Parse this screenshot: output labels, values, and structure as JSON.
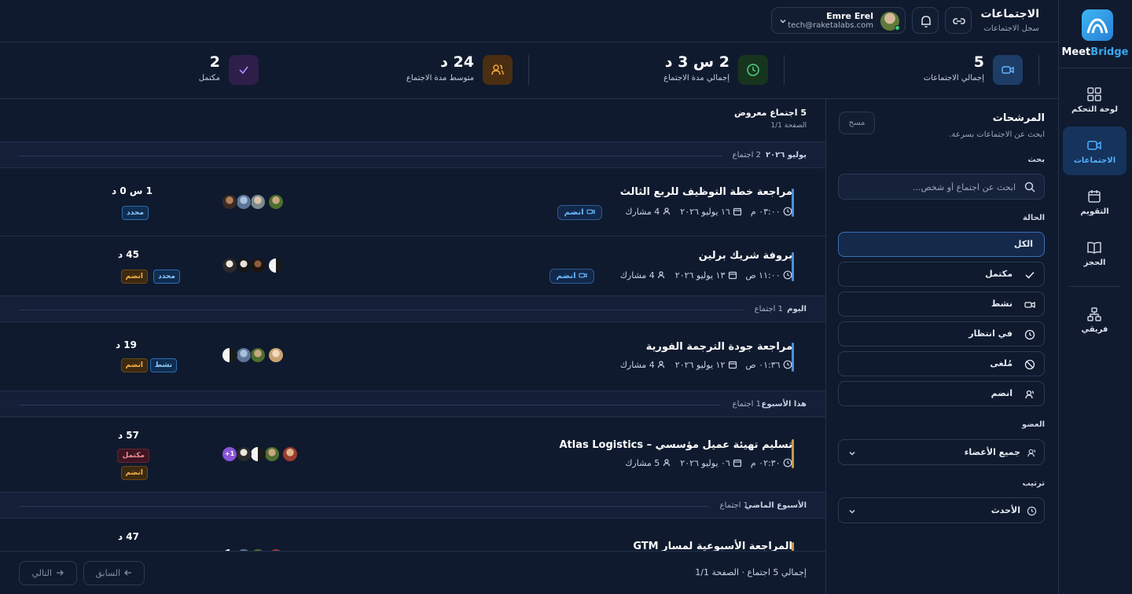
{
  "sidebar": {
    "brand_part1": "Meet",
    "brand_part2": "Bridge",
    "items": [
      {
        "label": "لوحة التحكم",
        "icon": "grid-icon"
      },
      {
        "label": "الاجتماعات",
        "icon": "video-icon"
      },
      {
        "label": "التقويم",
        "icon": "calendar-icon"
      },
      {
        "label": "الحجز",
        "icon": "book-icon"
      },
      {
        "label": "فريقي",
        "icon": "team-icon"
      }
    ]
  },
  "header": {
    "title": "الاجتماعات",
    "subtitle": "سجل الاجتماعات",
    "user": {
      "name": "Emre Erel",
      "email": "tech@raketalabs.com"
    }
  },
  "stats": [
    {
      "value": "5",
      "label": "إجمالي الاجتماعات",
      "icon": "video-icon",
      "color": "#1d3d66"
    },
    {
      "value": "2 س 3 د",
      "label": "إجمالي مدة الاجتماع",
      "icon": "clock-icon",
      "color": "#17341f"
    },
    {
      "value": "24 د",
      "label": "متوسط مدة الاجتماع",
      "icon": "users-icon",
      "color": "#4a2e12"
    },
    {
      "value": "2",
      "label": "مكتمل",
      "icon": "check-icon",
      "color": "#2d1f4a"
    }
  ],
  "filters": {
    "title": "المرشحات",
    "subtitle": "ابحث عن الاجتماعات بسرعة.",
    "clear": "مسح",
    "search_label": "بحث",
    "search_placeholder": "ابحث عن اجتماع أو شخص...",
    "status_label": "الحالة",
    "statuses": [
      "الكل",
      "مكتمل",
      "نشط",
      "في انتظار",
      "مُلغى",
      "انضم"
    ],
    "member_label": "العضو",
    "member_value": "جميع الأعضاء",
    "sort_label": "ترتيب",
    "sort_value": "الأحدث"
  },
  "list": {
    "count": "5 اجتماع معروض",
    "page": "الصفحة 1/1",
    "groups": [
      {
        "title": "يوليو ٢٠٢٦",
        "count": "2 اجتماع"
      },
      {
        "title": "اليوم",
        "count": "1 اجتماع"
      },
      {
        "title": "هذا الأسبوع",
        "count": "1 اجتماع"
      },
      {
        "title": "الأسبوع الماضي",
        "count": "1 اجتماع"
      }
    ],
    "meetings": [
      {
        "title": "مراجعة خطة التوظيف للربع الثالث",
        "time": "٠٣:٠٠ م",
        "date": "١٦ يوليو ٢٠٢٦",
        "participants": "4 مشارك",
        "join": "انضم",
        "duration": "1 س 0 د",
        "badges": [
          "محدد"
        ]
      },
      {
        "title": "بروفة شريك برلين",
        "time": "١١:٠٠ ص",
        "date": "١٣ يوليو ٢٠٢٦",
        "participants": "4 مشارك",
        "join": "انضم",
        "duration": "45 د",
        "badges": [
          "محدد",
          "انضم"
        ]
      },
      {
        "title": "مراجعة جودة الترجمة الفورية",
        "time": "٠١:٣٦ ص",
        "date": "١٢ يوليو ٢٠٢٦",
        "participants": "4 مشارك",
        "duration": "19 د",
        "badges": [
          "نشط",
          "انضم"
        ]
      },
      {
        "title": "تسليم تهيئة عميل مؤسسي – Atlas Logistics",
        "time": "٠٢:٣٠ م",
        "date": "٠٦ يوليو ٢٠٢٦",
        "participants": "5 مشارك",
        "duration": "57 د",
        "badges": [
          "مكتمل",
          "انضم"
        ],
        "more": "1+"
      },
      {
        "title": "المراجعة الأسبوعية لمسار GTM",
        "duration": "47 د"
      }
    ]
  },
  "footer": {
    "total": "إجمالي 5 اجتماع · الصفحة 1/1",
    "prev": "السابق",
    "next": "التالي"
  }
}
